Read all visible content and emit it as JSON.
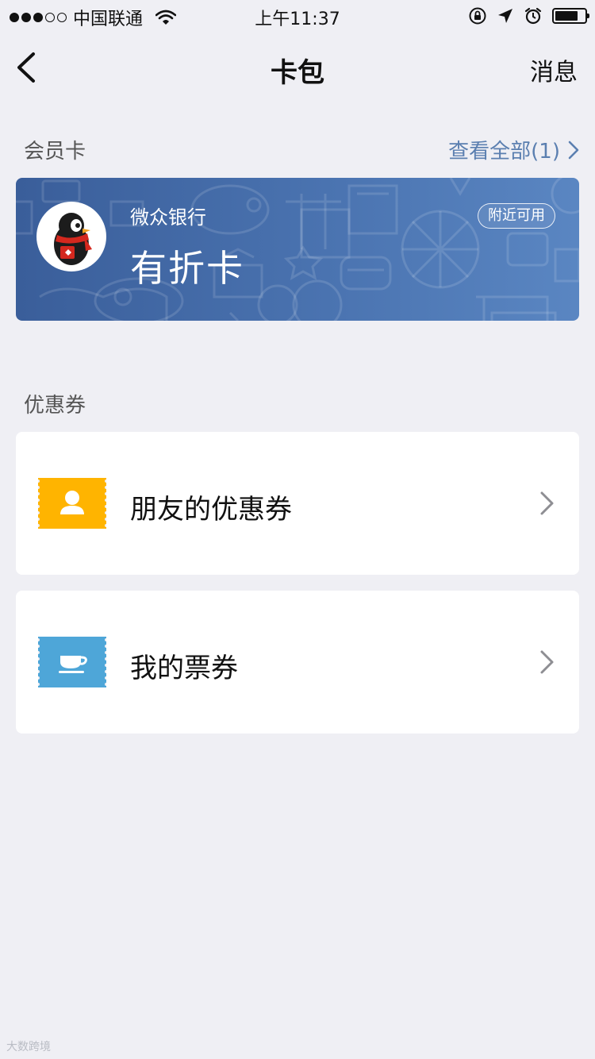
{
  "status_bar": {
    "carrier": "中国联通",
    "time": "上午11:37",
    "signal_bars_filled": 3,
    "signal_bars_total": 5,
    "battery_level": 0.8
  },
  "nav": {
    "title": "卡包",
    "right_label": "消息",
    "back_icon": "chevron-left-icon"
  },
  "member_section": {
    "label": "会员卡",
    "view_all": "查看全部(1)"
  },
  "member_card": {
    "bank": "微众银行",
    "name": "有折卡",
    "badge": "附近可用",
    "background_color": "#4a73b0"
  },
  "coupon_section": {
    "label": "优惠券",
    "items": [
      {
        "label": "朋友的优惠券",
        "icon": "person-ticket-icon",
        "color": "#ffb400"
      },
      {
        "label": "我的票券",
        "icon": "cup-ticket-icon",
        "color": "#4ea6d8"
      }
    ]
  },
  "watermark": "大数跨境"
}
